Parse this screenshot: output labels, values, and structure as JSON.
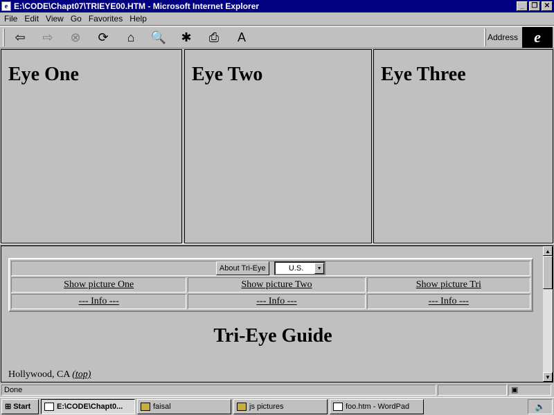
{
  "window": {
    "title": "E:\\CODE\\Chapt07\\TRIEYE00.HTM - Microsoft Internet Explorer",
    "app_icon": "ie-page-icon",
    "controls": [
      "_",
      "❐",
      "✕"
    ]
  },
  "menu": {
    "items": [
      "File",
      "Edit",
      "View",
      "Go",
      "Favorites",
      "Help"
    ]
  },
  "toolbar": {
    "buttons": [
      {
        "icon": "back-icon",
        "glyph": "⇦"
      },
      {
        "icon": "forward-icon",
        "glyph": "⇨"
      },
      {
        "icon": "stop-icon",
        "glyph": "⊗"
      },
      {
        "icon": "refresh-icon",
        "glyph": "⟳"
      },
      {
        "icon": "home-icon",
        "glyph": "⌂"
      },
      {
        "icon": "search-icon",
        "glyph": "🔍"
      },
      {
        "icon": "favorites-icon",
        "glyph": "✱"
      },
      {
        "icon": "print-icon",
        "glyph": "⎙"
      },
      {
        "icon": "font-icon",
        "glyph": "A"
      }
    ],
    "address_label": "Address",
    "logo_glyph": "e"
  },
  "frames": {
    "one": "Eye One",
    "two": "Eye Two",
    "three": "Eye Three"
  },
  "guide": {
    "about_button": "About Tri-Eye",
    "region_select": "U.S.",
    "pictures": [
      "Show picture One",
      "Show picture Two",
      "Show picture Tri"
    ],
    "info": [
      "--- Info ---",
      "--- Info ---",
      "--- Info ---"
    ],
    "title": "Tri-Eye Guide",
    "location": "Hollywood, CA",
    "top_link": "(top)"
  },
  "status": {
    "text": "Done"
  },
  "taskbar": {
    "start": "Start",
    "tasks": [
      "E:\\CODE\\Chapt0...",
      "faisal",
      "js pictures",
      "foo.htm - WordPad"
    ]
  }
}
